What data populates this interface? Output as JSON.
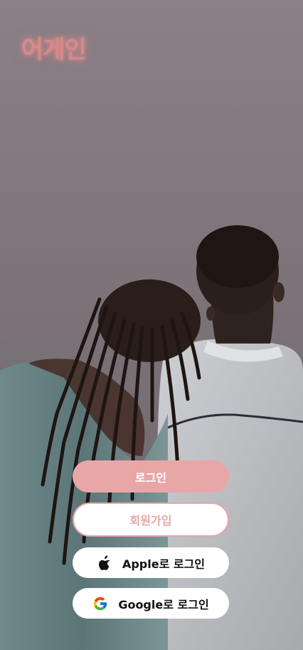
{
  "app": {
    "logo_text": "어게인"
  },
  "auth": {
    "login_label": "로그인",
    "signup_label": "회원가입",
    "apple_label": "Apple로 로그인",
    "google_label": "Google로 로그인"
  },
  "icons": {
    "apple": "apple-logo-icon",
    "google": "google-logo-icon"
  },
  "colors": {
    "accent_pink": "#e9a6a7",
    "logo_pink": "#d88a8a",
    "button_white": "#ffffff",
    "text_dark": "#111111"
  }
}
